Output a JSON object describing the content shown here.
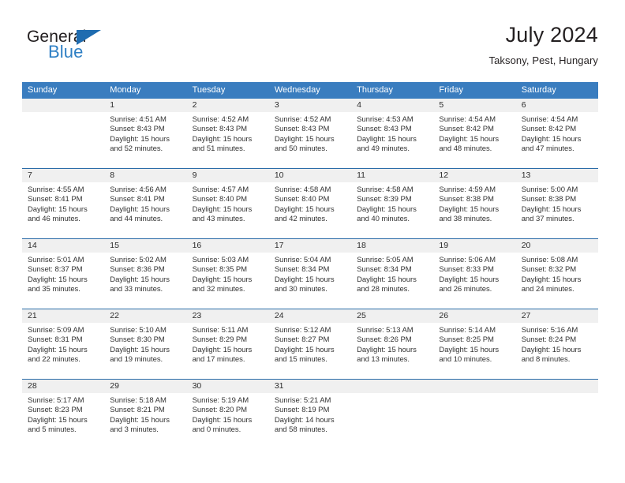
{
  "brand": {
    "name_part1": "General",
    "name_part2": "Blue",
    "triangle_icon": "triangle-icon",
    "accent_color": "#2e7fc4"
  },
  "header": {
    "title": "July 2024",
    "subtitle": "Taksony, Pest, Hungary"
  },
  "theme": {
    "header_blue": "#3a7dbf",
    "rule_blue": "#2b6ca8",
    "date_band_gray": "#f0f0f0",
    "text_dark": "#231f20"
  },
  "calendar": {
    "weekdays": [
      "Sunday",
      "Monday",
      "Tuesday",
      "Wednesday",
      "Thursday",
      "Friday",
      "Saturday"
    ],
    "weeks": [
      [
        {
          "day": "",
          "lines": [
            "",
            "",
            "",
            ""
          ]
        },
        {
          "day": "1",
          "lines": [
            "Sunrise: 4:51 AM",
            "Sunset: 8:43 PM",
            "Daylight: 15 hours",
            "and 52 minutes."
          ]
        },
        {
          "day": "2",
          "lines": [
            "Sunrise: 4:52 AM",
            "Sunset: 8:43 PM",
            "Daylight: 15 hours",
            "and 51 minutes."
          ]
        },
        {
          "day": "3",
          "lines": [
            "Sunrise: 4:52 AM",
            "Sunset: 8:43 PM",
            "Daylight: 15 hours",
            "and 50 minutes."
          ]
        },
        {
          "day": "4",
          "lines": [
            "Sunrise: 4:53 AM",
            "Sunset: 8:43 PM",
            "Daylight: 15 hours",
            "and 49 minutes."
          ]
        },
        {
          "day": "5",
          "lines": [
            "Sunrise: 4:54 AM",
            "Sunset: 8:42 PM",
            "Daylight: 15 hours",
            "and 48 minutes."
          ]
        },
        {
          "day": "6",
          "lines": [
            "Sunrise: 4:54 AM",
            "Sunset: 8:42 PM",
            "Daylight: 15 hours",
            "and 47 minutes."
          ]
        }
      ],
      [
        {
          "day": "7",
          "lines": [
            "Sunrise: 4:55 AM",
            "Sunset: 8:41 PM",
            "Daylight: 15 hours",
            "and 46 minutes."
          ]
        },
        {
          "day": "8",
          "lines": [
            "Sunrise: 4:56 AM",
            "Sunset: 8:41 PM",
            "Daylight: 15 hours",
            "and 44 minutes."
          ]
        },
        {
          "day": "9",
          "lines": [
            "Sunrise: 4:57 AM",
            "Sunset: 8:40 PM",
            "Daylight: 15 hours",
            "and 43 minutes."
          ]
        },
        {
          "day": "10",
          "lines": [
            "Sunrise: 4:58 AM",
            "Sunset: 8:40 PM",
            "Daylight: 15 hours",
            "and 42 minutes."
          ]
        },
        {
          "day": "11",
          "lines": [
            "Sunrise: 4:58 AM",
            "Sunset: 8:39 PM",
            "Daylight: 15 hours",
            "and 40 minutes."
          ]
        },
        {
          "day": "12",
          "lines": [
            "Sunrise: 4:59 AM",
            "Sunset: 8:38 PM",
            "Daylight: 15 hours",
            "and 38 minutes."
          ]
        },
        {
          "day": "13",
          "lines": [
            "Sunrise: 5:00 AM",
            "Sunset: 8:38 PM",
            "Daylight: 15 hours",
            "and 37 minutes."
          ]
        }
      ],
      [
        {
          "day": "14",
          "lines": [
            "Sunrise: 5:01 AM",
            "Sunset: 8:37 PM",
            "Daylight: 15 hours",
            "and 35 minutes."
          ]
        },
        {
          "day": "15",
          "lines": [
            "Sunrise: 5:02 AM",
            "Sunset: 8:36 PM",
            "Daylight: 15 hours",
            "and 33 minutes."
          ]
        },
        {
          "day": "16",
          "lines": [
            "Sunrise: 5:03 AM",
            "Sunset: 8:35 PM",
            "Daylight: 15 hours",
            "and 32 minutes."
          ]
        },
        {
          "day": "17",
          "lines": [
            "Sunrise: 5:04 AM",
            "Sunset: 8:34 PM",
            "Daylight: 15 hours",
            "and 30 minutes."
          ]
        },
        {
          "day": "18",
          "lines": [
            "Sunrise: 5:05 AM",
            "Sunset: 8:34 PM",
            "Daylight: 15 hours",
            "and 28 minutes."
          ]
        },
        {
          "day": "19",
          "lines": [
            "Sunrise: 5:06 AM",
            "Sunset: 8:33 PM",
            "Daylight: 15 hours",
            "and 26 minutes."
          ]
        },
        {
          "day": "20",
          "lines": [
            "Sunrise: 5:08 AM",
            "Sunset: 8:32 PM",
            "Daylight: 15 hours",
            "and 24 minutes."
          ]
        }
      ],
      [
        {
          "day": "21",
          "lines": [
            "Sunrise: 5:09 AM",
            "Sunset: 8:31 PM",
            "Daylight: 15 hours",
            "and 22 minutes."
          ]
        },
        {
          "day": "22",
          "lines": [
            "Sunrise: 5:10 AM",
            "Sunset: 8:30 PM",
            "Daylight: 15 hours",
            "and 19 minutes."
          ]
        },
        {
          "day": "23",
          "lines": [
            "Sunrise: 5:11 AM",
            "Sunset: 8:29 PM",
            "Daylight: 15 hours",
            "and 17 minutes."
          ]
        },
        {
          "day": "24",
          "lines": [
            "Sunrise: 5:12 AM",
            "Sunset: 8:27 PM",
            "Daylight: 15 hours",
            "and 15 minutes."
          ]
        },
        {
          "day": "25",
          "lines": [
            "Sunrise: 5:13 AM",
            "Sunset: 8:26 PM",
            "Daylight: 15 hours",
            "and 13 minutes."
          ]
        },
        {
          "day": "26",
          "lines": [
            "Sunrise: 5:14 AM",
            "Sunset: 8:25 PM",
            "Daylight: 15 hours",
            "and 10 minutes."
          ]
        },
        {
          "day": "27",
          "lines": [
            "Sunrise: 5:16 AM",
            "Sunset: 8:24 PM",
            "Daylight: 15 hours",
            "and 8 minutes."
          ]
        }
      ],
      [
        {
          "day": "28",
          "lines": [
            "Sunrise: 5:17 AM",
            "Sunset: 8:23 PM",
            "Daylight: 15 hours",
            "and 5 minutes."
          ]
        },
        {
          "day": "29",
          "lines": [
            "Sunrise: 5:18 AM",
            "Sunset: 8:21 PM",
            "Daylight: 15 hours",
            "and 3 minutes."
          ]
        },
        {
          "day": "30",
          "lines": [
            "Sunrise: 5:19 AM",
            "Sunset: 8:20 PM",
            "Daylight: 15 hours",
            "and 0 minutes."
          ]
        },
        {
          "day": "31",
          "lines": [
            "Sunrise: 5:21 AM",
            "Sunset: 8:19 PM",
            "Daylight: 14 hours",
            "and 58 minutes."
          ]
        },
        {
          "day": "",
          "lines": [
            "",
            "",
            "",
            ""
          ]
        },
        {
          "day": "",
          "lines": [
            "",
            "",
            "",
            ""
          ]
        },
        {
          "day": "",
          "lines": [
            "",
            "",
            "",
            ""
          ]
        }
      ]
    ]
  }
}
